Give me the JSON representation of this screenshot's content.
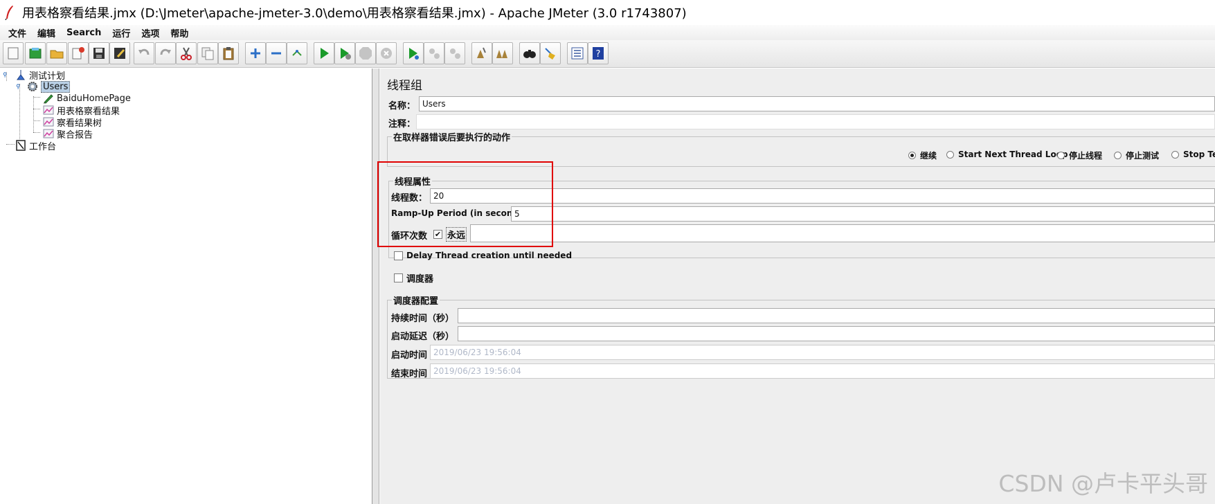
{
  "window": {
    "title": "用表格察看结果.jmx (D:\\Jmeter\\apache-jmeter-3.0\\demo\\用表格察看结果.jmx) - Apache JMeter (3.0 r1743807)"
  },
  "menu": [
    "文件",
    "编辑",
    "Search",
    "运行",
    "选项",
    "帮助"
  ],
  "toolbar": [
    {
      "name": "new-icon",
      "color": "#f4f4f4"
    },
    {
      "name": "templates-icon",
      "color": "#2e9e3b"
    },
    {
      "name": "open-icon",
      "color": "#e8b23a"
    },
    {
      "name": "close-icon",
      "color": "#d93a2b"
    },
    {
      "name": "save-icon",
      "color": "#333333"
    },
    {
      "name": "save-as-icon",
      "color": "#333333"
    },
    {
      "name": "undo-icon",
      "color": "#a0a0a0"
    },
    {
      "name": "redo-icon",
      "color": "#a0a0a0"
    },
    {
      "name": "cut-icon",
      "color": "#c8202a"
    },
    {
      "name": "copy-icon",
      "color": "#909090"
    },
    {
      "name": "paste-icon",
      "color": "#a67c3a"
    },
    {
      "name": "expand-icon",
      "color": "#2b6fc7"
    },
    {
      "name": "collapse-icon",
      "color": "#2b6fc7"
    },
    {
      "name": "toggle-icon",
      "color": "#3a9a3a"
    },
    {
      "name": "start-icon",
      "color": "#1a9a2a"
    },
    {
      "name": "start-no-pause-icon",
      "color": "#1a9a2a"
    },
    {
      "name": "stop-icon",
      "color": "#b0b0b0"
    },
    {
      "name": "shutdown-icon",
      "color": "#b0b0b0"
    },
    {
      "name": "remote-start-icon",
      "color": "#1a9a2a"
    },
    {
      "name": "remote-stop-icon",
      "color": "#b0b0b0"
    },
    {
      "name": "remote-shutdown-icon",
      "color": "#b0b0b0"
    },
    {
      "name": "clear-icon",
      "color": "#a8823a"
    },
    {
      "name": "clear-all-icon",
      "color": "#a8823a"
    },
    {
      "name": "search-icon",
      "color": "#222222"
    },
    {
      "name": "reset-search-icon",
      "color": "#e0b020"
    },
    {
      "name": "function-helper-icon",
      "color": "#3a5aa0"
    },
    {
      "name": "help-icon",
      "color": "#2040a0"
    }
  ],
  "tree": {
    "test_plan": "测试计划",
    "thread_group": "Users",
    "children": [
      "BaiduHomePage",
      "用表格察看结果",
      "察看结果树",
      "聚合报告"
    ],
    "workbench": "工作台"
  },
  "editor": {
    "heading": "线程组",
    "name_label": "名称：",
    "name_value": "Users",
    "comment_label": "注释：",
    "comment_value": "",
    "error_action": {
      "title": "在取样器错误后要执行的动作",
      "options": [
        "继续",
        "Start Next Thread Loop",
        "停止线程",
        "停止测试",
        "Stop Test Now"
      ],
      "selected": 0
    },
    "thread_props": {
      "title": "线程属性",
      "threads_label": "线程数：",
      "threads_value": "20",
      "rampup_label": "Ramp-Up Period (in seconds):",
      "rampup_value": "5",
      "loop_label": "循环次数",
      "forever_label": "永远",
      "forever_checked": true,
      "loop_value": ""
    },
    "delay_label": "Delay Thread creation until needed",
    "scheduler_label": "调度器",
    "scheduler": {
      "title": "调度器配置",
      "duration_label": "持续时间（秒）",
      "duration_value": "",
      "startup_delay_label": "启动延迟（秒）",
      "startup_delay_value": "",
      "start_time_label": "启动时间",
      "start_time_value": "2019/06/23 19:56:04",
      "end_time_label": "结束时间",
      "end_time_value": "2019/06/23 19:56:04"
    }
  },
  "watermark": "CSDN @卢卡平头哥"
}
